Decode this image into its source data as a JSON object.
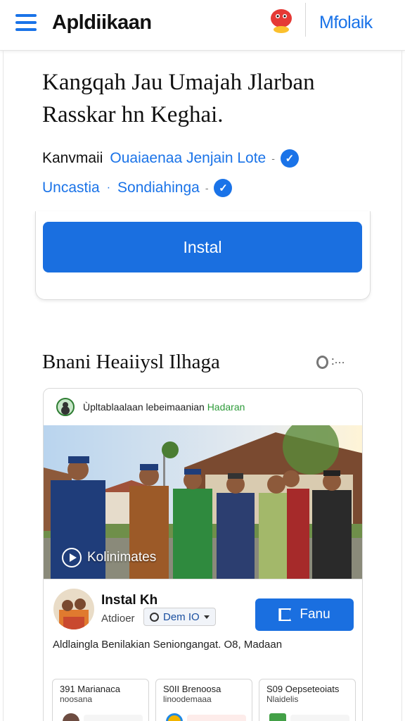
{
  "appbar": {
    "title": "Apldiikaan",
    "link": "Mfolaik"
  },
  "headline": "Kangqah Jau Umajah Jlarban Rasskar hn Keghai.",
  "meta": {
    "row1": {
      "plain": "Kanvmaii",
      "link": "Ouaiaenaa Jenjain Lote"
    },
    "row2": {
      "link1": "Uncastia",
      "link2": "Sondiahinga"
    }
  },
  "install_label": "Instal",
  "section": {
    "title": "Bnani Heaiiysl Ilhaga"
  },
  "post": {
    "header": {
      "text": "Ùpltablaalaan lebeimaanian",
      "accent": "Hadaran"
    },
    "photo_label": "Kolinimates",
    "author": {
      "name": "Instal Kh",
      "sub": "Atdioer",
      "tag": "Dem IO"
    },
    "share_label": "Fanu",
    "description": "Aldlaingla Benilakian Seniongangat. O8, Madaan",
    "cards": [
      {
        "l1": "391 Marianaca",
        "l2": "noosana"
      },
      {
        "l1": "S0II Brenoosa",
        "l2": "linoodemaaa"
      },
      {
        "l1": "S09 Oepseteoiats",
        "l2": "Nlaidelis"
      }
    ]
  },
  "colors": {
    "accent": "#1a6fe0",
    "link": "#1a73e8",
    "green": "#2e9b3a"
  }
}
